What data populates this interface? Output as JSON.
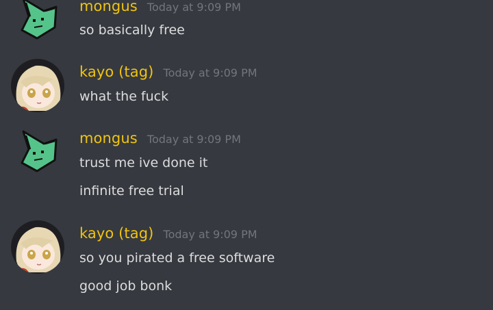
{
  "messages": [
    {
      "author": "mongus",
      "timestamp": "Today at 9:09 PM",
      "avatar": "green-alien-avatar",
      "lines": [
        "so basically free"
      ]
    },
    {
      "author": "kayo (tag)",
      "timestamp": "Today at 9:09 PM",
      "avatar": "anime-girl-avatar",
      "lines": [
        "what the fuck"
      ]
    },
    {
      "author": "mongus",
      "timestamp": "Today at 9:09 PM",
      "avatar": "green-alien-avatar",
      "lines": [
        "trust me ive done it",
        "infinite free trial"
      ]
    },
    {
      "author": "kayo (tag)",
      "timestamp": "Today at 9:09 PM",
      "avatar": "anime-girl-avatar",
      "lines": [
        "so you pirated a free software",
        "good job bonk"
      ]
    }
  ],
  "colors": {
    "background": "#36393f",
    "username": "#f1c40f",
    "timestamp": "#72767d",
    "text": "#dcddde"
  }
}
